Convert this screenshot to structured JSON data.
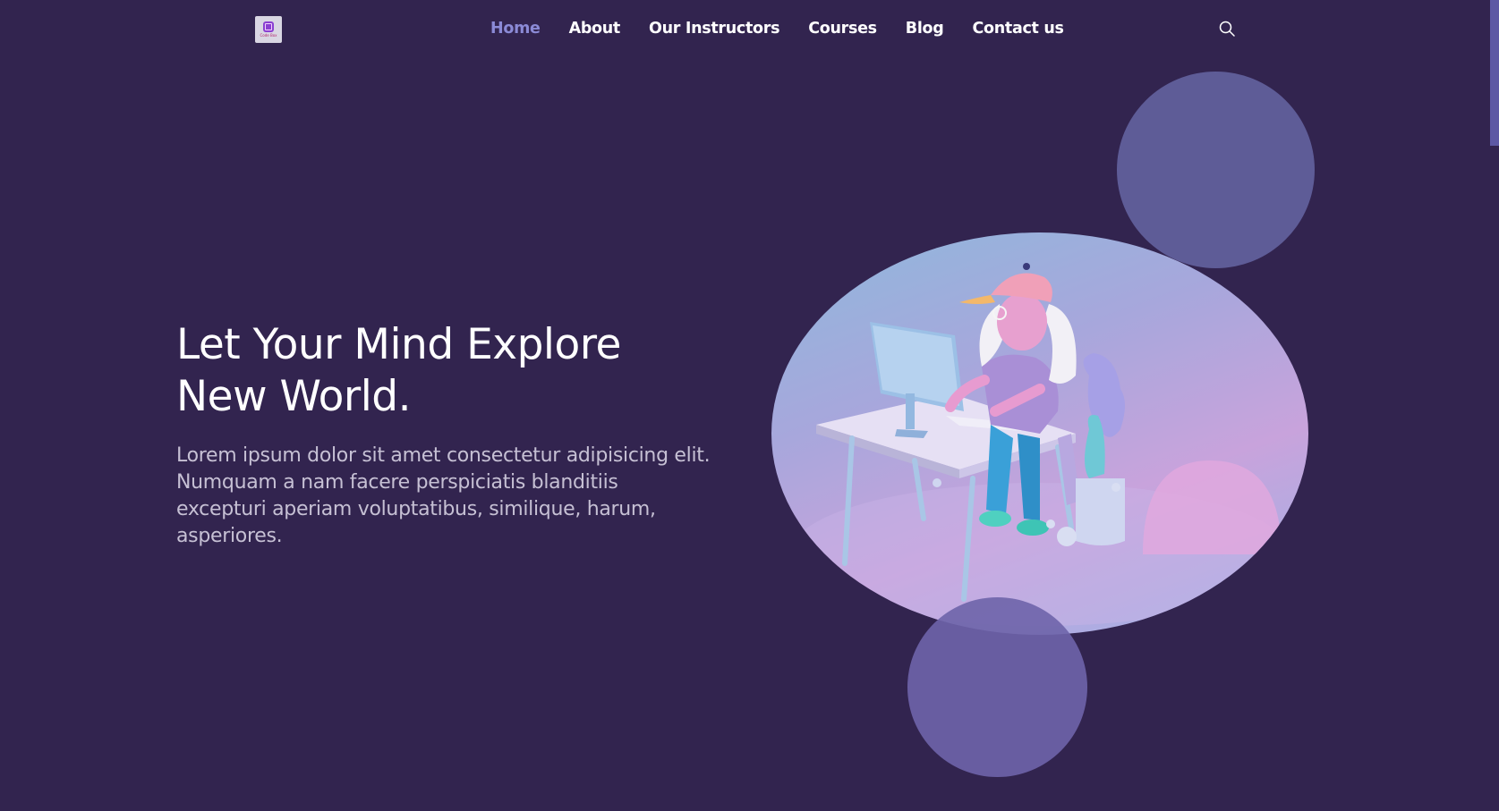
{
  "header": {
    "logo_text": "Code Box",
    "nav": [
      {
        "label": "Home",
        "active": true
      },
      {
        "label": "About",
        "active": false
      },
      {
        "label": "Our Instructors",
        "active": false
      },
      {
        "label": "Courses",
        "active": false
      },
      {
        "label": "Blog",
        "active": false
      },
      {
        "label": "Contact us",
        "active": false
      }
    ],
    "search_icon": "search-icon"
  },
  "hero": {
    "title_line1": "Let Your Mind Explore",
    "title_line2": "New World.",
    "description": "Lorem ipsum dolor sit amet consectetur adipisicing elit. Numquam a nam facere perspiciatis blanditiis excepturi aperiam voluptatibus, similique, harum, asperiores."
  },
  "colors": {
    "background": "#32244f",
    "nav_active": "#8b8ad6",
    "circle": "#5e5c97",
    "text_muted": "#c6c0d4"
  }
}
